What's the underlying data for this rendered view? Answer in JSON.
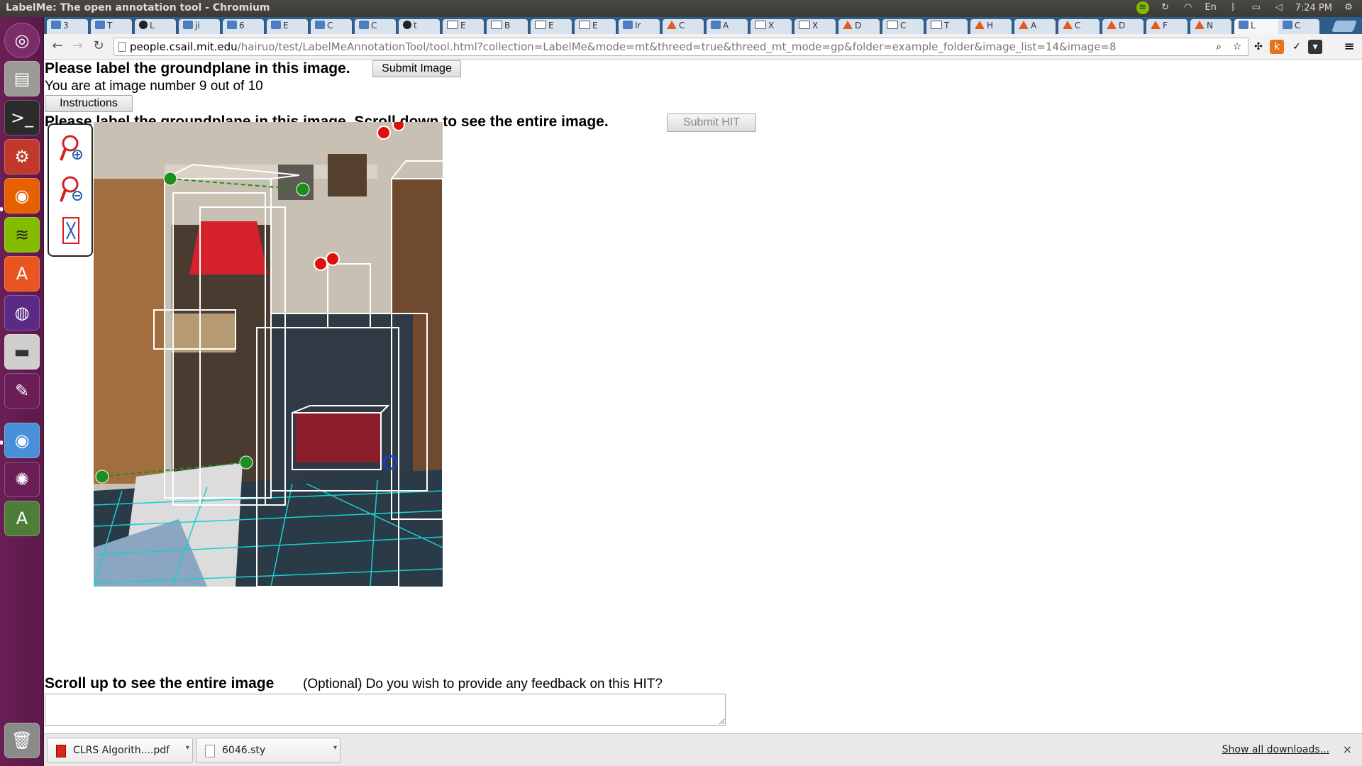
{
  "os": {
    "window_title": "LabelMe: The open annotation tool - Chromium",
    "clock": "7:24 PM",
    "keyboard": "En"
  },
  "tabs": [
    {
      "label": "3"
    },
    {
      "label": "T"
    },
    {
      "label": "L"
    },
    {
      "label": "ji"
    },
    {
      "label": "6"
    },
    {
      "label": "E"
    },
    {
      "label": "C"
    },
    {
      "label": "C"
    },
    {
      "label": "t"
    },
    {
      "label": "E"
    },
    {
      "label": "B"
    },
    {
      "label": "E"
    },
    {
      "label": "E"
    },
    {
      "label": "Ir"
    },
    {
      "label": "C"
    },
    {
      "label": "A"
    },
    {
      "label": "X"
    },
    {
      "label": "X"
    },
    {
      "label": "D"
    },
    {
      "label": "C"
    },
    {
      "label": "T"
    },
    {
      "label": "H"
    },
    {
      "label": "A"
    },
    {
      "label": "C"
    },
    {
      "label": "D"
    },
    {
      "label": "F"
    },
    {
      "label": "N"
    },
    {
      "label": "L"
    },
    {
      "label": "C"
    }
  ],
  "address": {
    "host": "people.csail.mit.edu",
    "path": "/hairuo/test/LabelMeAnnotationTool/tool.html?collection=LabelMe&mode=mt&threed=true&threed_mt_mode=gp&folder=example_folder&image_list=14&image=8"
  },
  "page": {
    "title": "Please label the groundplane in this image.",
    "submit_image": "Submit Image",
    "progress_text": "You are at image number 9 out of 10",
    "instructions": "Instructions",
    "subtitle": "Please label the groundplane in this image. Scroll down to see the entire image.",
    "submit_hit": "Submit HIT",
    "scroll_up": "Scroll up to see the entire image",
    "feedback_question": "(Optional) Do you wish to provide any feedback on this HIT?",
    "feedback_value": ""
  },
  "tools": [
    {
      "icon": "zoom-in-icon"
    },
    {
      "icon": "zoom-out-icon"
    },
    {
      "icon": "fit-image-icon"
    }
  ],
  "downloads": {
    "items": [
      {
        "name": "CLRS Algorith....pdf",
        "type": "pdf"
      },
      {
        "name": "6046.sty",
        "type": "file"
      }
    ],
    "show_all": "Show all downloads..."
  },
  "colors": {
    "launcher": "#5e1a4b",
    "tabstrip": "#2f5d8a",
    "annotation_green": "#1e8f1e",
    "annotation_red": "#e01010",
    "annotation_blue": "#1a3cc8",
    "grid_cyan": "#19d0d0"
  }
}
